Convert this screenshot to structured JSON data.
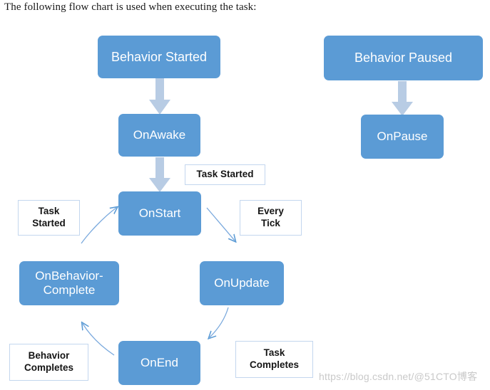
{
  "caption": "The following flow chart is used when executing the task:",
  "watermark": "https://blog.csdn.net/@51CTO博客",
  "colors": {
    "node_fill": "#5b9bd5",
    "node_text": "#ffffff",
    "block_arrow": "#b8cce4",
    "curve_arrow": "#5b9bd5",
    "label_border": "#c3d6ee",
    "label_text": "#151515",
    "caption_text": "#1a1a1a",
    "background": "#ffffff",
    "watermark_text": "#c9c9c9"
  },
  "chart_data": {
    "type": "diagram",
    "title": "The following flow chart is used when executing the task:",
    "nodes": [
      {
        "id": "behavior-started",
        "label": "Behavior Started"
      },
      {
        "id": "on-awake",
        "label": "OnAwake"
      },
      {
        "id": "on-start",
        "label": "OnStart"
      },
      {
        "id": "on-behavior-complete",
        "label": "OnBehavior-\nComplete"
      },
      {
        "id": "on-update",
        "label": "OnUpdate"
      },
      {
        "id": "on-end",
        "label": "OnEnd"
      },
      {
        "id": "behavior-paused",
        "label": "Behavior Paused"
      },
      {
        "id": "on-pause",
        "label": "OnPause"
      }
    ],
    "edge_labels": [
      {
        "id": "task-started-top",
        "label": "Task Started"
      },
      {
        "id": "task-started-left",
        "label": "Task\nStarted"
      },
      {
        "id": "every-tick",
        "label": "Every\nTick"
      },
      {
        "id": "behavior-completes",
        "label": "Behavior\nCompletes"
      },
      {
        "id": "task-completes",
        "label": "Task\nCompletes"
      }
    ],
    "edges": [
      {
        "from": "behavior-started",
        "to": "on-awake",
        "style": "block-arrow",
        "label": ""
      },
      {
        "from": "on-awake",
        "to": "on-start",
        "style": "block-arrow",
        "label": "Task Started"
      },
      {
        "from": "on-end",
        "to": "on-start",
        "style": "curve-arrow",
        "label": "Task Started"
      },
      {
        "from": "on-start",
        "to": "on-update",
        "style": "curve-arrow",
        "label": "Every Tick"
      },
      {
        "from": "on-end",
        "to": "on-behavior-complete",
        "style": "curve-arrow",
        "label": "Behavior Completes"
      },
      {
        "from": "on-update",
        "to": "on-end",
        "style": "curve-arrow",
        "label": "Task Completes"
      },
      {
        "from": "behavior-paused",
        "to": "on-pause",
        "style": "block-arrow",
        "label": ""
      }
    ]
  },
  "nodes": {
    "behavior_started": {
      "label": "Behavior Started"
    },
    "on_awake": {
      "label": "OnAwake"
    },
    "on_start": {
      "label": "OnStart"
    },
    "on_behavior_complete": {
      "line1": "OnBehavior-",
      "line2": "Complete"
    },
    "on_update": {
      "label": "OnUpdate"
    },
    "on_end": {
      "label": "OnEnd"
    },
    "behavior_paused": {
      "label": "Behavior Paused"
    },
    "on_pause": {
      "label": "OnPause"
    }
  },
  "labels": {
    "task_started_top": {
      "label": "Task Started"
    },
    "task_started_left": {
      "line1": "Task",
      "line2": "Started"
    },
    "every_tick": {
      "line1": "Every",
      "line2": "Tick"
    },
    "behavior_completes": {
      "line1": "Behavior",
      "line2": "Completes"
    },
    "task_completes": {
      "line1": "Task",
      "line2": "Completes"
    }
  }
}
